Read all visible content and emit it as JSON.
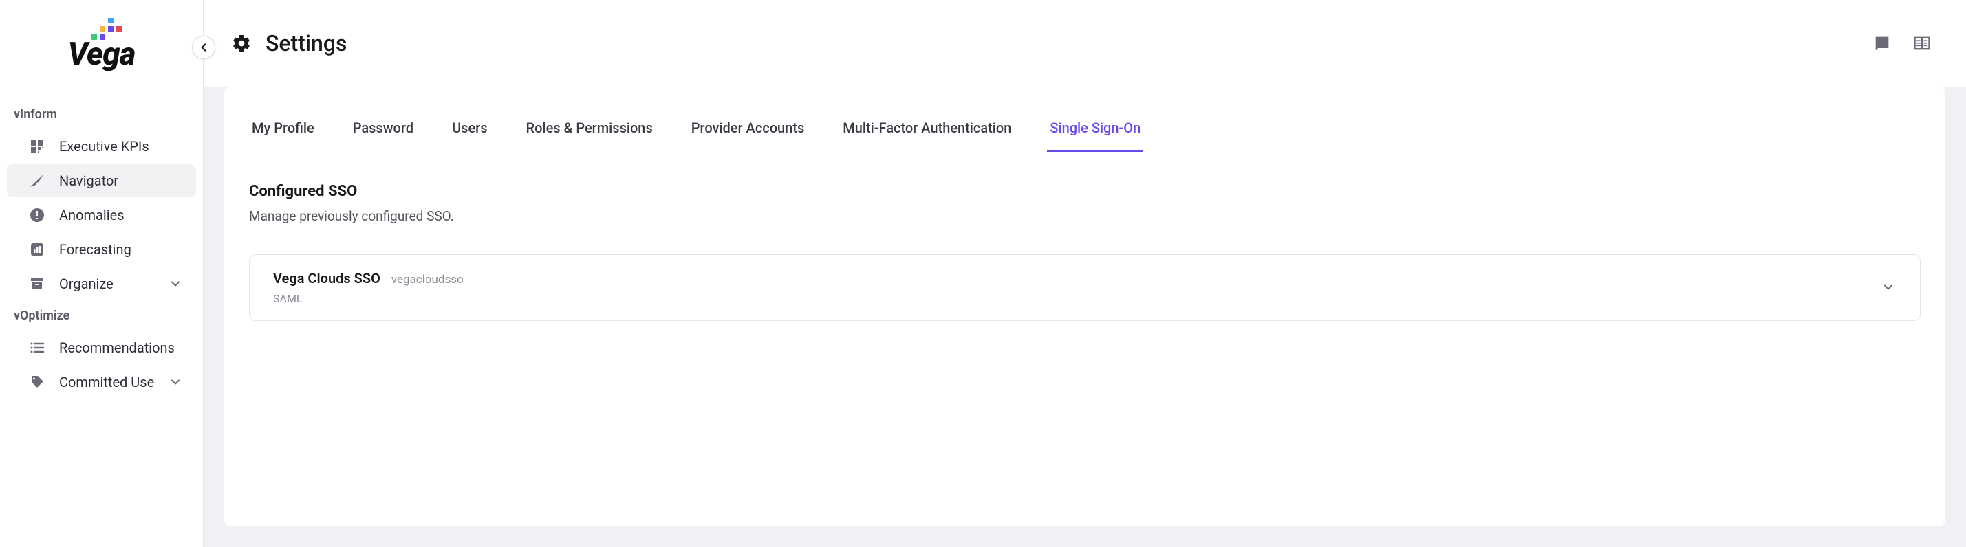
{
  "brand": {
    "name": "Vega"
  },
  "page": {
    "title": "Settings"
  },
  "sidebar": {
    "sections": [
      {
        "label": "vInform",
        "items": [
          {
            "label": "Executive KPIs",
            "icon": "dashboard-icon",
            "active": false,
            "expandable": false
          },
          {
            "label": "Navigator",
            "icon": "navigator-icon",
            "active": true,
            "expandable": false
          },
          {
            "label": "Anomalies",
            "icon": "alert-icon",
            "active": false,
            "expandable": false
          },
          {
            "label": "Forecasting",
            "icon": "chart-icon",
            "active": false,
            "expandable": false
          },
          {
            "label": "Organize",
            "icon": "archive-icon",
            "active": false,
            "expandable": true
          }
        ]
      },
      {
        "label": "vOptimize",
        "items": [
          {
            "label": "Recommendations",
            "icon": "list-icon",
            "active": false,
            "expandable": false
          },
          {
            "label": "Committed Use",
            "icon": "tag-icon",
            "active": false,
            "expandable": true
          }
        ]
      }
    ]
  },
  "tabs": [
    {
      "label": "My Profile",
      "active": false
    },
    {
      "label": "Password",
      "active": false
    },
    {
      "label": "Users",
      "active": false
    },
    {
      "label": "Roles & Permissions",
      "active": false
    },
    {
      "label": "Provider Accounts",
      "active": false
    },
    {
      "label": "Multi-Factor Authentication",
      "active": false
    },
    {
      "label": "Single Sign-On",
      "active": true
    }
  ],
  "sso": {
    "heading": "Configured SSO",
    "subheading": "Manage previously configured SSO.",
    "items": [
      {
        "name": "Vega Clouds SSO",
        "slug": "vegacloudsso",
        "type": "SAML"
      }
    ]
  }
}
